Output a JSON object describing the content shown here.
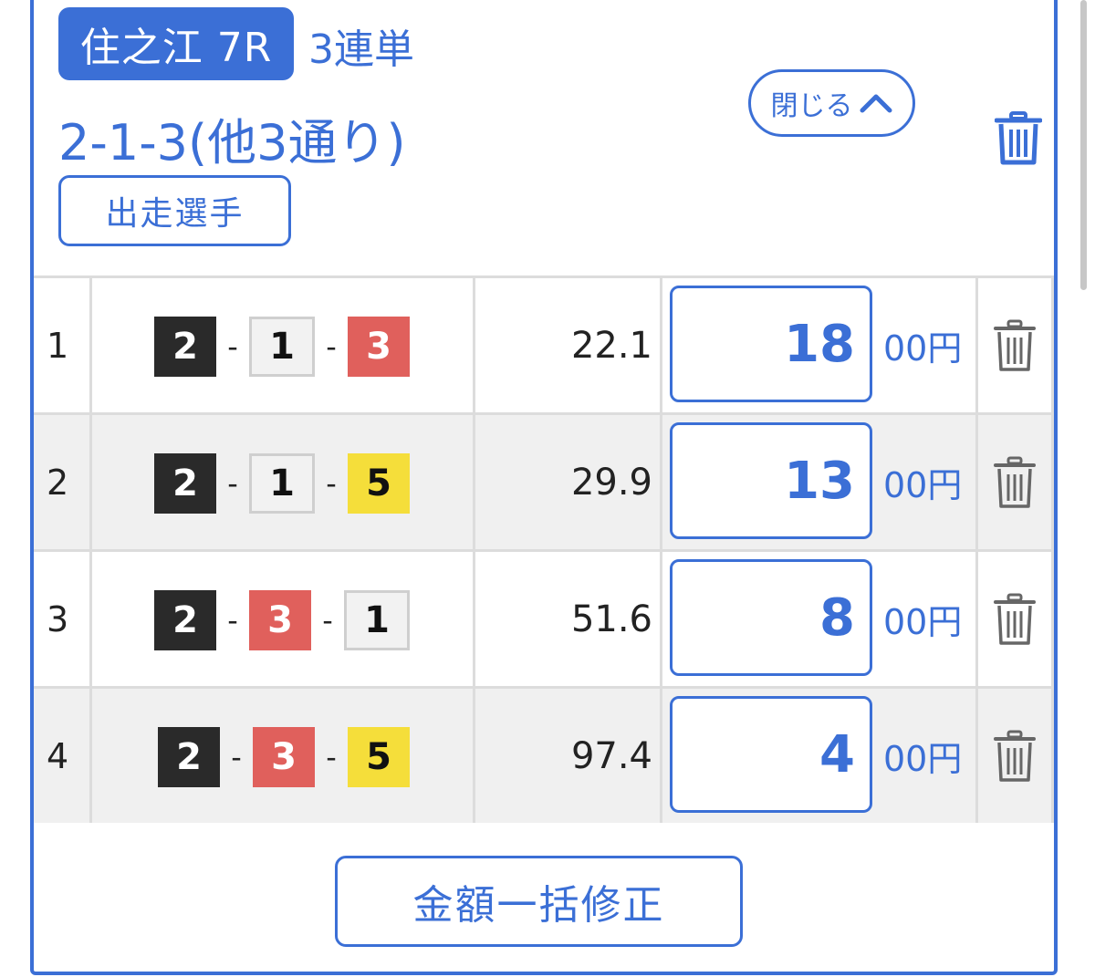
{
  "header": {
    "venue_race": "住之江 7R",
    "bet_type": "3連単",
    "combo_summary": "2-1-3(他3通り)",
    "players_button": "出走選手",
    "close_button": "閉じる"
  },
  "bets": [
    {
      "index": "1",
      "first": "2",
      "second": "1",
      "third": "3",
      "odds": "22.1",
      "amount": "18",
      "unit": "00円"
    },
    {
      "index": "2",
      "first": "2",
      "second": "1",
      "third": "5",
      "odds": "29.9",
      "amount": "13",
      "unit": "00円"
    },
    {
      "index": "3",
      "first": "2",
      "second": "3",
      "third": "1",
      "odds": "51.6",
      "amount": "8",
      "unit": "00円"
    },
    {
      "index": "4",
      "first": "2",
      "second": "3",
      "third": "5",
      "odds": "97.4",
      "amount": "4",
      "unit": "00円"
    }
  ],
  "combo_separator": "-",
  "bulk_edit_button": "金額一括修正",
  "colors": {
    "accent": "#3b6fd6",
    "boat_1": "#f2f2f2",
    "boat_2": "#2a2a2a",
    "boat_3": "#e0605c",
    "boat_5": "#f5de3a"
  },
  "icons": {
    "close": "chevron-up-icon",
    "delete": "trash-icon"
  }
}
